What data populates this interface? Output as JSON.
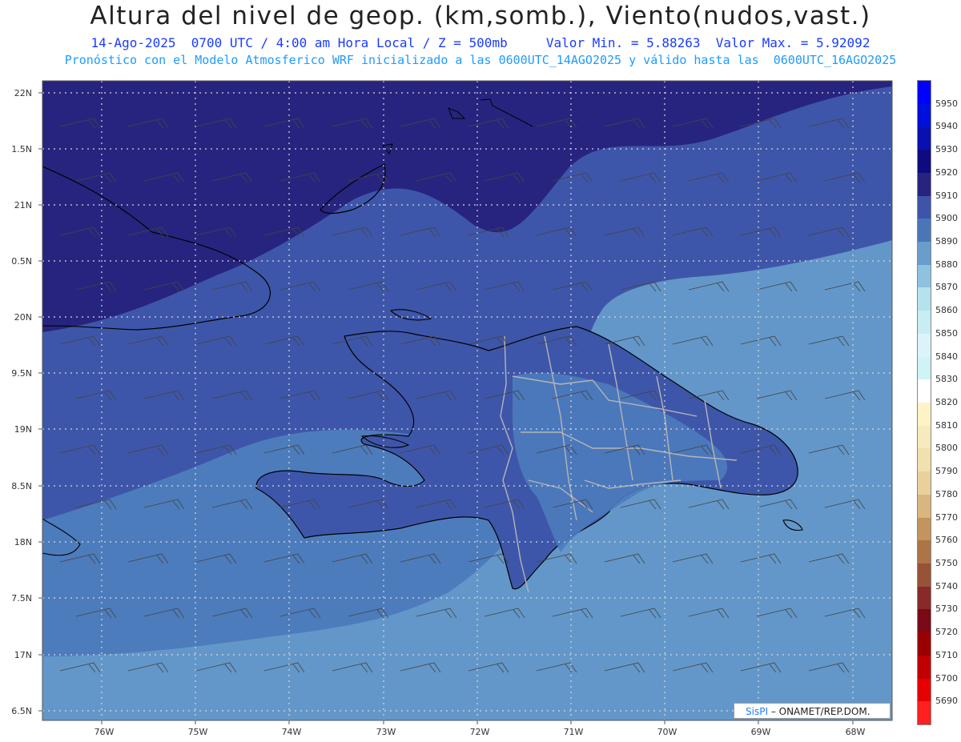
{
  "header": {
    "title": "Altura del nivel de geop. (km,somb.), Viento(nudos,vast.)",
    "line1": "14-Ago-2025  0700 UTC / 4:00 am Hora Local / Z = 500mb     Valor Min. = 5.88263  Valor Max. = 5.92092",
    "line2": "Pronóstico con el Modelo Atmosferico WRF inicializado a las 0600UTC_14AGO2025 y válido hasta las  0600UTC_16AGO2025"
  },
  "axes": {
    "lat_labels": [
      "22N",
      "1.5N",
      "21N",
      "0.5N",
      "20N",
      "9.5N",
      "19N",
      "8.5N",
      "18N",
      "7.5N",
      "17N",
      "6.5N"
    ],
    "lon_labels": [
      "76W",
      "75W",
      "74W",
      "73W",
      "72W",
      "71W",
      "70W",
      "69W",
      "68W"
    ]
  },
  "colorbar": {
    "labels": [
      "5950",
      "5940",
      "5930",
      "5920",
      "5910",
      "5900",
      "5890",
      "5880",
      "5870",
      "5860",
      "5850",
      "5840",
      "5830",
      "5820",
      "5810",
      "5800",
      "5790",
      "5780",
      "5770",
      "5760",
      "5750",
      "5740",
      "5730",
      "5720",
      "5710",
      "5700",
      "5690"
    ],
    "colors": [
      "#0000ff",
      "#0010dc",
      "#0a10b0",
      "#100a80",
      "#27237f",
      "#3d54a8",
      "#4a76b8",
      "#6a9ccc",
      "#8ec2df",
      "#b6e2ee",
      "#c9edf5",
      "#dcf4f9",
      "#d0f3f5",
      "#ffffff",
      "#fdf3c6",
      "#f7ebbd",
      "#f1e1ae",
      "#ead19c",
      "#d9b57f",
      "#c39360",
      "#ad7448",
      "#985238",
      "#882a28",
      "#7a0a18",
      "#9a0000",
      "#c00000",
      "#e60000",
      "#ff2020"
    ]
  },
  "field_colors": {
    "z5920": "#27237f",
    "z5910": "#3d54a8",
    "z5900": "#4a78b8",
    "z5890": "#5d8fc6",
    "land": "#3d54a8"
  },
  "credit": {
    "brand": "SisPI",
    "text": "– ONAMET/REP.DOM."
  }
}
